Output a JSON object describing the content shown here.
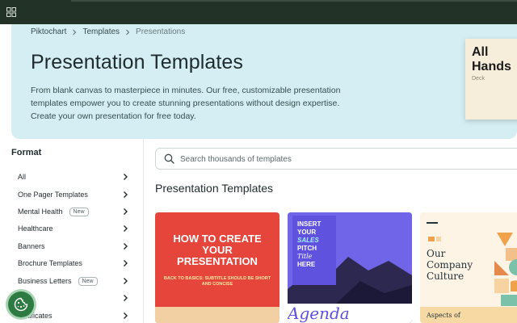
{
  "breadcrumb": [
    "Piktochart",
    "Templates",
    "Presentations"
  ],
  "hero": {
    "title": "Presentation Templates",
    "description": "From blank canvas to masterpiece in minutes. Our free, customizable presentation templates empower you to create stunning presentations without design expertise. Create your own presentation for free today.",
    "card_title": "All Hands",
    "card_subtitle": "Deck"
  },
  "sidebar": {
    "heading": "Format",
    "items": [
      {
        "label": "All",
        "badge": ""
      },
      {
        "label": "One Pager Templates",
        "badge": ""
      },
      {
        "label": "Mental Health",
        "badge": "New"
      },
      {
        "label": "Healthcare",
        "badge": ""
      },
      {
        "label": "Banners",
        "badge": ""
      },
      {
        "label": "Brochure Templates",
        "badge": ""
      },
      {
        "label": "Business Letters",
        "badge": "New"
      },
      {
        "label": "…s",
        "badge": ""
      },
      {
        "label": "…rtificates",
        "badge": ""
      }
    ]
  },
  "search": {
    "placeholder": "Search thousands of templates"
  },
  "section_title": "Presentation Templates",
  "cards": {
    "card1": {
      "title": "HOW TO CREATE YOUR PRESENTATION",
      "subtitle": "BACK TO BASICS: SUBTITLE SHOULD BE SHORT AND CONCISE"
    },
    "card2": {
      "line1": "INSERT",
      "line2": "YOUR",
      "line3": "SALES",
      "line4": "PITCH",
      "line5": "Title",
      "line6": "HERE",
      "bottom": "Agenda"
    },
    "card3": {
      "title": "Our Company Culture",
      "bottom": "Aspects of"
    }
  },
  "colors": {
    "topbar": "#233226",
    "hero_bg": "#d4eef3",
    "cookie_button": "#2e7a43"
  },
  "icons": {
    "topbar": "grid-icon",
    "breadcrumb_separator": "chevron-right-icon",
    "sidebar_chevron": "chevron-right-icon",
    "search": "search-icon",
    "cookie": "cookie-icon"
  }
}
